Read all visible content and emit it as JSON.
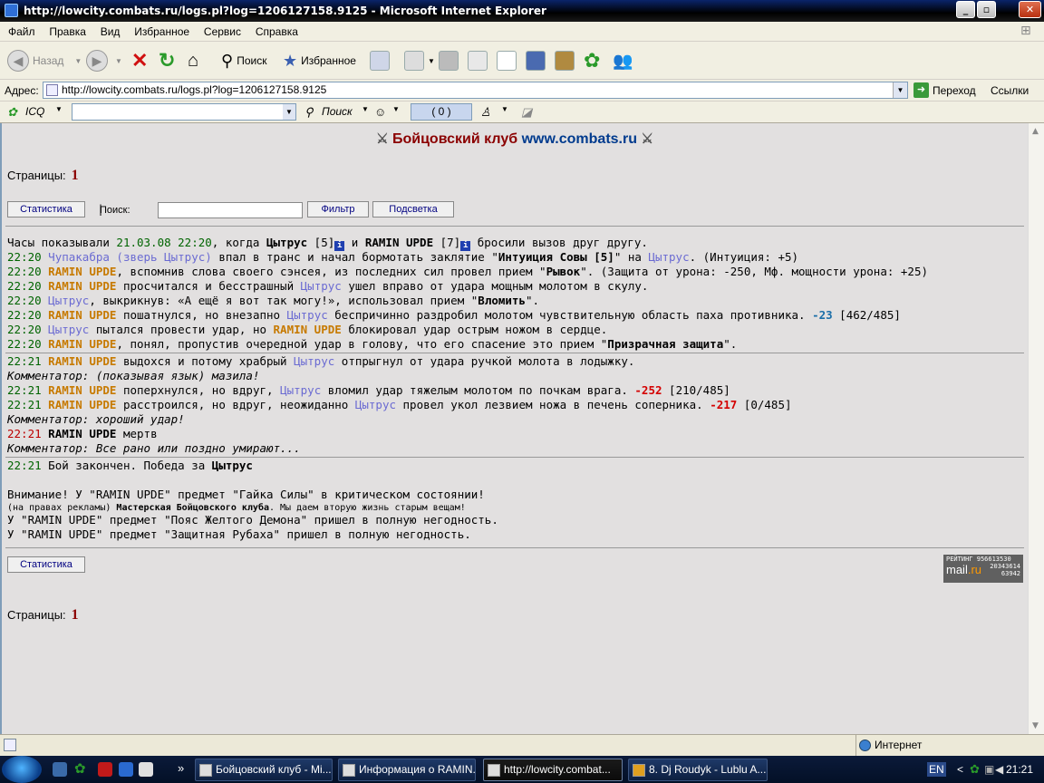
{
  "window": {
    "title": "http://lowcity.combats.ru/logs.pl?log=1206127158.9125 - Microsoft Internet Explorer"
  },
  "menu": [
    "Файл",
    "Правка",
    "Вид",
    "Избранное",
    "Сервис",
    "Справка"
  ],
  "toolbar": {
    "back": "Назад",
    "search": "Поиск",
    "favorites": "Избранное"
  },
  "address": {
    "label": "Адрес:",
    "url": "http://lowcity.combats.ru/logs.pl?log=1206127158.9125",
    "go": "Переход",
    "links": "Ссылки"
  },
  "icqbar": {
    "icq": "ICQ",
    "search": "Поиск",
    "counter": "( 0 )"
  },
  "page": {
    "header_left": "Бойцовский клуб",
    "header_right": "www.combats.ru",
    "pages_label": "Страницы:",
    "pages_num": "1",
    "btn_stats": "Статистика",
    "sep": "|",
    "search_label": "Поиск:",
    "btn_filter": "Фильтр",
    "btn_highlight": "Подсветка"
  },
  "log": {
    "l1": {
      "a": "Часы показывали ",
      "date": "21.03.08 22:20",
      "b": ", когда ",
      "p1": "Цытрус",
      "lv1": " [5]",
      "c": " и ",
      "p2": "RAMIN UPDE",
      "lv2": " [7]",
      "d": " бросили вызов друг другу."
    },
    "l2": {
      "t": "22:20",
      "p": "Чупакабра (зверь Цытрус)",
      "a": " впал в транс и начал бормотать заклятие \"",
      "s": "Интуиция Совы [5]",
      "b": "\" на ",
      "p2": "Цытрус",
      "c": ". (Интуиция: +5)"
    },
    "l3": {
      "t": "22:20",
      "p": "RAMIN UPDE",
      "a": ", вспомнив слова своего сэнсея, из последних сил провел прием \"",
      "s": "Рывок",
      "b": "\". (Защита от урона: -250, Мф. мощности урона: +25)"
    },
    "l4": {
      "t": "22:20",
      "p": "RAMIN UPDE",
      "a": " просчитался и бесстрашный ",
      "p2": "Цытрус",
      "b": " ушел вправо от удара мощным молотом в скулу."
    },
    "l5": {
      "t": "22:20",
      "p": "Цытрус",
      "a": ", выкрикнув: «А ещё я вот так могу!», использовал прием \"",
      "s": "Вломить",
      "b": "\"."
    },
    "l6": {
      "t": "22:20",
      "p": "RAMIN UPDE",
      "a": " пошатнулся, но внезапно ",
      "p2": "Цытрус",
      "b": " беспричинно раздробил молотом чувствительную область паха противника. ",
      "v": "-23",
      "hp": " [462/485]"
    },
    "l7": {
      "t": "22:20",
      "p": "Цытрус",
      "a": " пытался провести удар, но ",
      "p2": "RAMIN UPDE",
      "b": " блокировал удар острым ножом в сердце."
    },
    "l8": {
      "t": "22:20",
      "p": "RAMIN UPDE",
      "a": ", понял, пропустив очередной удар в голову, что его спасение это прием \"",
      "s": "Призрачная защита",
      "b": "\"."
    },
    "l9": {
      "t": "22:21",
      "p": "RAMIN UPDE",
      "a": " выдохся и потому храбрый ",
      "p2": "Цытрус",
      "b": " отпрыгнул от удара ручкой молота в лодыжку."
    },
    "l10": {
      "text": "Комментатор: (показывая язык) мазила!"
    },
    "l11": {
      "t": "22:21",
      "p": "RAMIN UPDE",
      "a": " поперхнулся, но вдруг, ",
      "p2": "Цытрус",
      "b": " вломил удар тяжелым молотом по почкам врага. ",
      "v": "-252",
      "hp": " [210/485]"
    },
    "l12": {
      "t": "22:21",
      "p": "RAMIN UPDE",
      "a": " расстроился, но вдруг, неожиданно ",
      "p2": "Цытрус",
      "b": " провел укол лезвием ножа в печень соперника. ",
      "v": "-217",
      "hp": " [0/485]"
    },
    "l13": {
      "text": "Комментатор: хороший удар!"
    },
    "l14": {
      "t": "22:21",
      "p": "RAMIN UPDE",
      "a": " мертв"
    },
    "l15": {
      "text": "Комментатор: Все рано или поздно умирают..."
    },
    "l16": {
      "t": "22:21",
      "a": " Бой закончен. Победа за ",
      "p": "Цытрус"
    },
    "w1": "Внимание! У \"RAMIN UPDE\" предмет \"Гайка Силы\" в критическом состоянии!",
    "w2a": "(на правах рекламы) ",
    "w2b": "Мастерская Бойцовского клуба",
    "w2c": ". Мы даем вторую жизнь старым вещам!",
    "w3": "У \"RAMIN UPDE\" предмет \"Пояс Желтого Демона\" пришел в полную негодность.",
    "w4": "У \"RAMIN UPDE\" предмет \"Защитная Рубаха\" пришел в полную негодность."
  },
  "rating": {
    "label": "РЕЙТИНГ",
    "n1": "956613530",
    "n2": "20343614",
    "n3": "63942",
    "brand_a": "mail",
    "brand_b": ".ru"
  },
  "statusbar": {
    "zone": "Интернет"
  },
  "taskbar": {
    "tasks": [
      "Бойцовский клуб - Mi...",
      "Информация о RAMIN...",
      "http://lowcity.combat...",
      "8. Dj Roudyk - Lublu A..."
    ],
    "lang": "EN",
    "time": "21:21",
    "more": "»"
  },
  "colors": {
    "time": "#006400",
    "player_blue": "#6b6bd2",
    "player_orange": "#c77a00",
    "damage": "#d40000",
    "heal": "#1a6ea8"
  }
}
